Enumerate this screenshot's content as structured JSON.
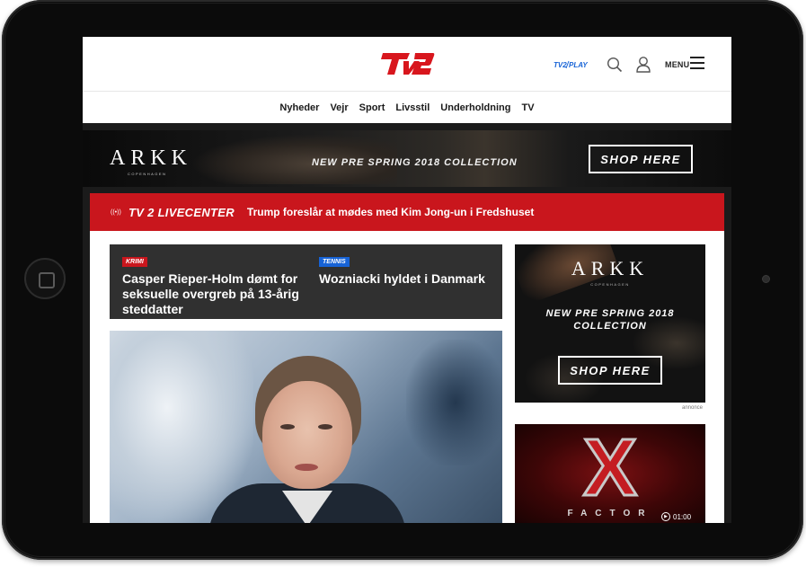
{
  "header": {
    "logo_text": "TV2",
    "play_logo_text": "TV2 PLAY",
    "menu_label": "MENU"
  },
  "nav": {
    "items": [
      {
        "label": "Nyheder"
      },
      {
        "label": "Vejr"
      },
      {
        "label": "Sport"
      },
      {
        "label": "Livsstil"
      },
      {
        "label": "Underholdning"
      },
      {
        "label": "TV"
      }
    ]
  },
  "banner_ad": {
    "brand": "ARKK",
    "brand_sub": "COPENHAGEN",
    "tagline": "NEW PRE SPRING 2018 COLLECTION",
    "cta": "SHOP HERE"
  },
  "livecenter": {
    "title": "TV 2 LIVECENTER",
    "headline": "Trump foreslår at mødes med Kim Jong-un i Fredshuset"
  },
  "news": [
    {
      "tag": "KRIMI",
      "title": "Casper Rieper-Holm dømt for seksuelle overgreb på 13-årig steddatter"
    },
    {
      "tag": "TENNIS",
      "title": "Wozniacki hyldet i Danmark"
    }
  ],
  "side_ad": {
    "brand": "ARKK",
    "brand_sub": "COPENHAGEN",
    "tagline_line1": "NEW PRE SPRING 2018",
    "tagline_line2": "COLLECTION",
    "cta": "SHOP HERE",
    "label": "annonce"
  },
  "video": {
    "title": "X",
    "subtitle": "FACTOR",
    "duration": "01:00"
  },
  "colors": {
    "brand_red": "#c9161d",
    "tag_blue": "#1763d6",
    "dark_strip": "#303030"
  }
}
